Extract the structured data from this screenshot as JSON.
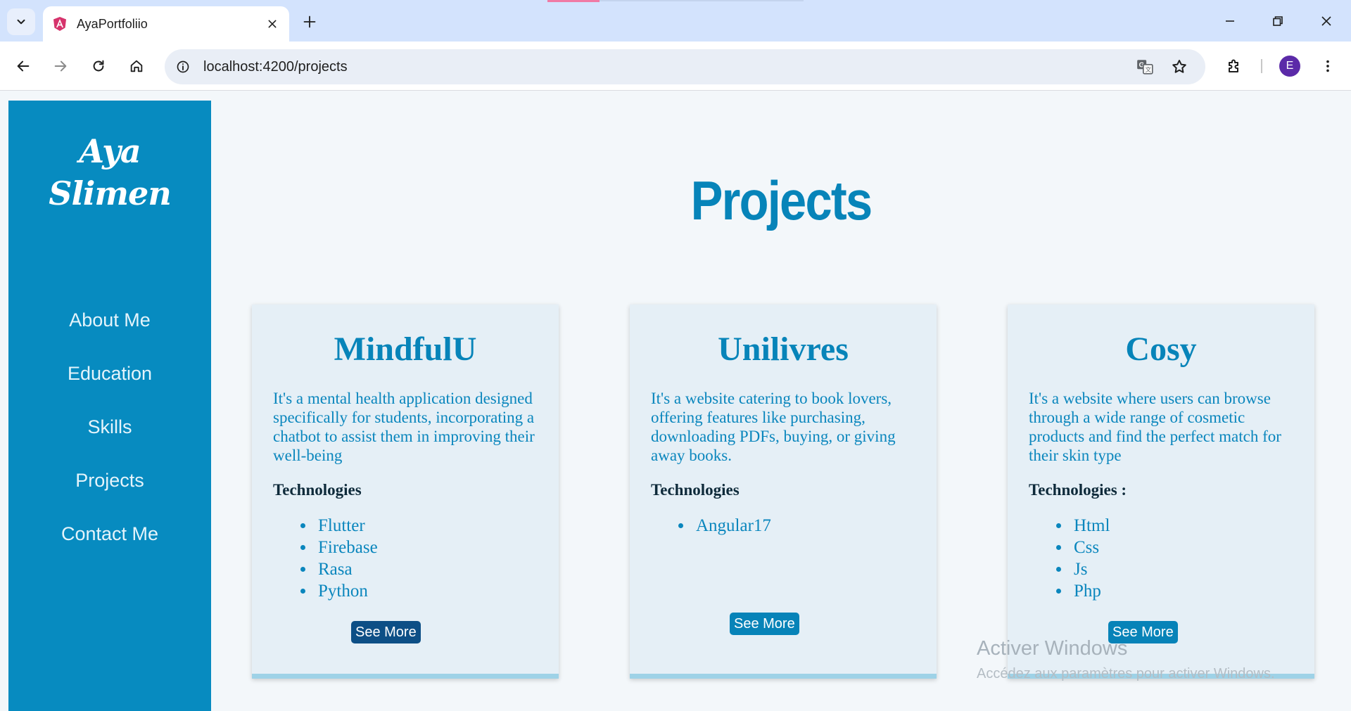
{
  "browser": {
    "tab_title": "AyaPortfoliio",
    "url": "localhost:4200/projects",
    "profile_initial": "E"
  },
  "sidebar": {
    "logo_line1": "Aya",
    "logo_line2": "Slimen",
    "items": [
      {
        "label": "About Me"
      },
      {
        "label": "Education"
      },
      {
        "label": "Skills"
      },
      {
        "label": "Projects"
      },
      {
        "label": "Contact Me"
      }
    ]
  },
  "main": {
    "title": "Projects",
    "projects": [
      {
        "name": "MindfulU",
        "description": "It's a mental health application designed specifically for students, incorporating a chatbot to assist them in improving their well-being",
        "tech_label": "Technologies",
        "technologies": [
          "Flutter",
          "Firebase",
          "Rasa",
          "Python"
        ],
        "button": "See More"
      },
      {
        "name": "Unilivres",
        "description": "It's a website catering to book lovers, offering features like purchasing, downloading PDFs, buying, or giving away books.",
        "tech_label": "Technologies",
        "technologies": [
          "Angular17"
        ],
        "button": "See More"
      },
      {
        "name": "Cosy",
        "description": "It's a website where users can browse through a wide range of cosmetic products and find the perfect match for their skin type",
        "tech_label": "Technologies :",
        "technologies": [
          "Html",
          "Css",
          "Js",
          "Php"
        ],
        "button": "See More"
      }
    ]
  },
  "watermark": {
    "line1": "Activer Windows",
    "line2": "Accédez aux paramètres pour activer Windows."
  },
  "colors": {
    "sidebar": "#078bc0",
    "accent": "#0784b9",
    "button_dark": "#0d4f86",
    "button": "#0783b8"
  }
}
